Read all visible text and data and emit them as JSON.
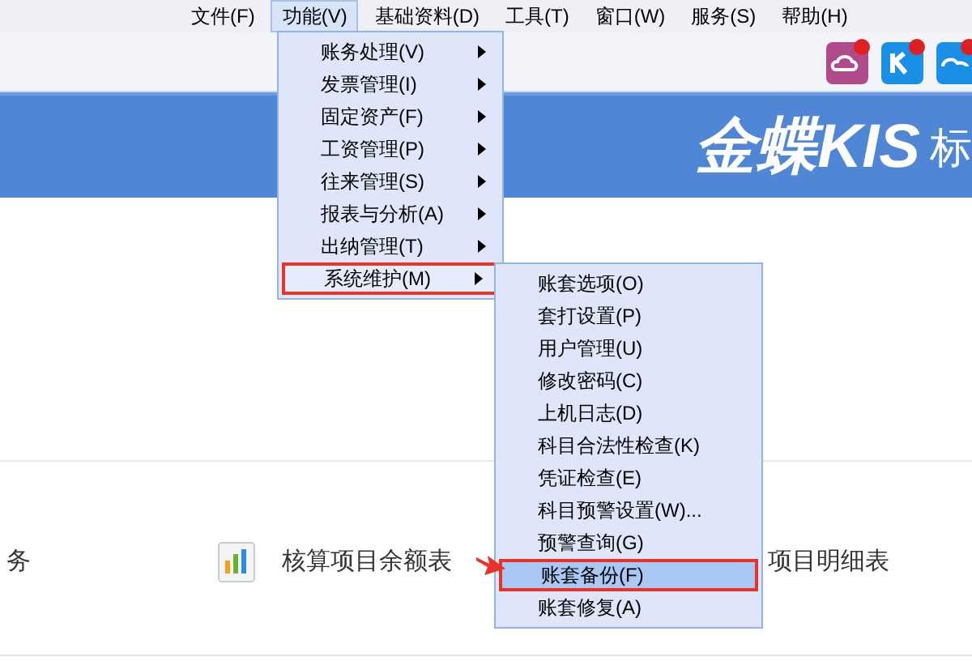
{
  "menu_bar": [
    {
      "label": "文件(F)",
      "selected": false
    },
    {
      "label": "功能(V)",
      "selected": true
    },
    {
      "label": "基础资料(D)",
      "selected": false
    },
    {
      "label": "工具(T)",
      "selected": false
    },
    {
      "label": "窗口(W)",
      "selected": false
    },
    {
      "label": "服务(S)",
      "selected": false
    },
    {
      "label": "帮助(H)",
      "selected": false
    }
  ],
  "banner": {
    "logo": "金蝶KIS",
    "suffix": "标"
  },
  "content_row": [
    {
      "kind": "text",
      "label": "务"
    },
    {
      "kind": "report",
      "label": "核算项目余额表"
    },
    {
      "kind": "text",
      "label": "项目明细表"
    }
  ],
  "function_menu": [
    {
      "label": "账务处理(V)",
      "selected": false
    },
    {
      "label": "发票管理(I)",
      "selected": false
    },
    {
      "label": "固定资产(F)",
      "selected": false
    },
    {
      "label": "工资管理(P)",
      "selected": false
    },
    {
      "label": "往来管理(S)",
      "selected": false
    },
    {
      "label": "报表与分析(A)",
      "selected": false
    },
    {
      "label": "出纳管理(T)",
      "selected": false
    },
    {
      "label": "系统维护(M)",
      "selected": true
    }
  ],
  "system_submenu": [
    {
      "label": "账套选项(O)",
      "selected": false
    },
    {
      "label": "套打设置(P)",
      "selected": false
    },
    {
      "label": "用户管理(U)",
      "selected": false
    },
    {
      "label": "修改密码(C)",
      "selected": false
    },
    {
      "label": "上机日志(D)",
      "selected": false
    },
    {
      "label": "科目合法性检查(K)",
      "selected": false
    },
    {
      "label": "凭证检查(E)",
      "selected": false
    },
    {
      "label": "科目预警设置(W)...",
      "selected": false
    },
    {
      "label": "预警查询(G)",
      "selected": false
    },
    {
      "label": "账套备份(F)",
      "selected": true
    },
    {
      "label": "账套修复(A)",
      "selected": false
    }
  ]
}
